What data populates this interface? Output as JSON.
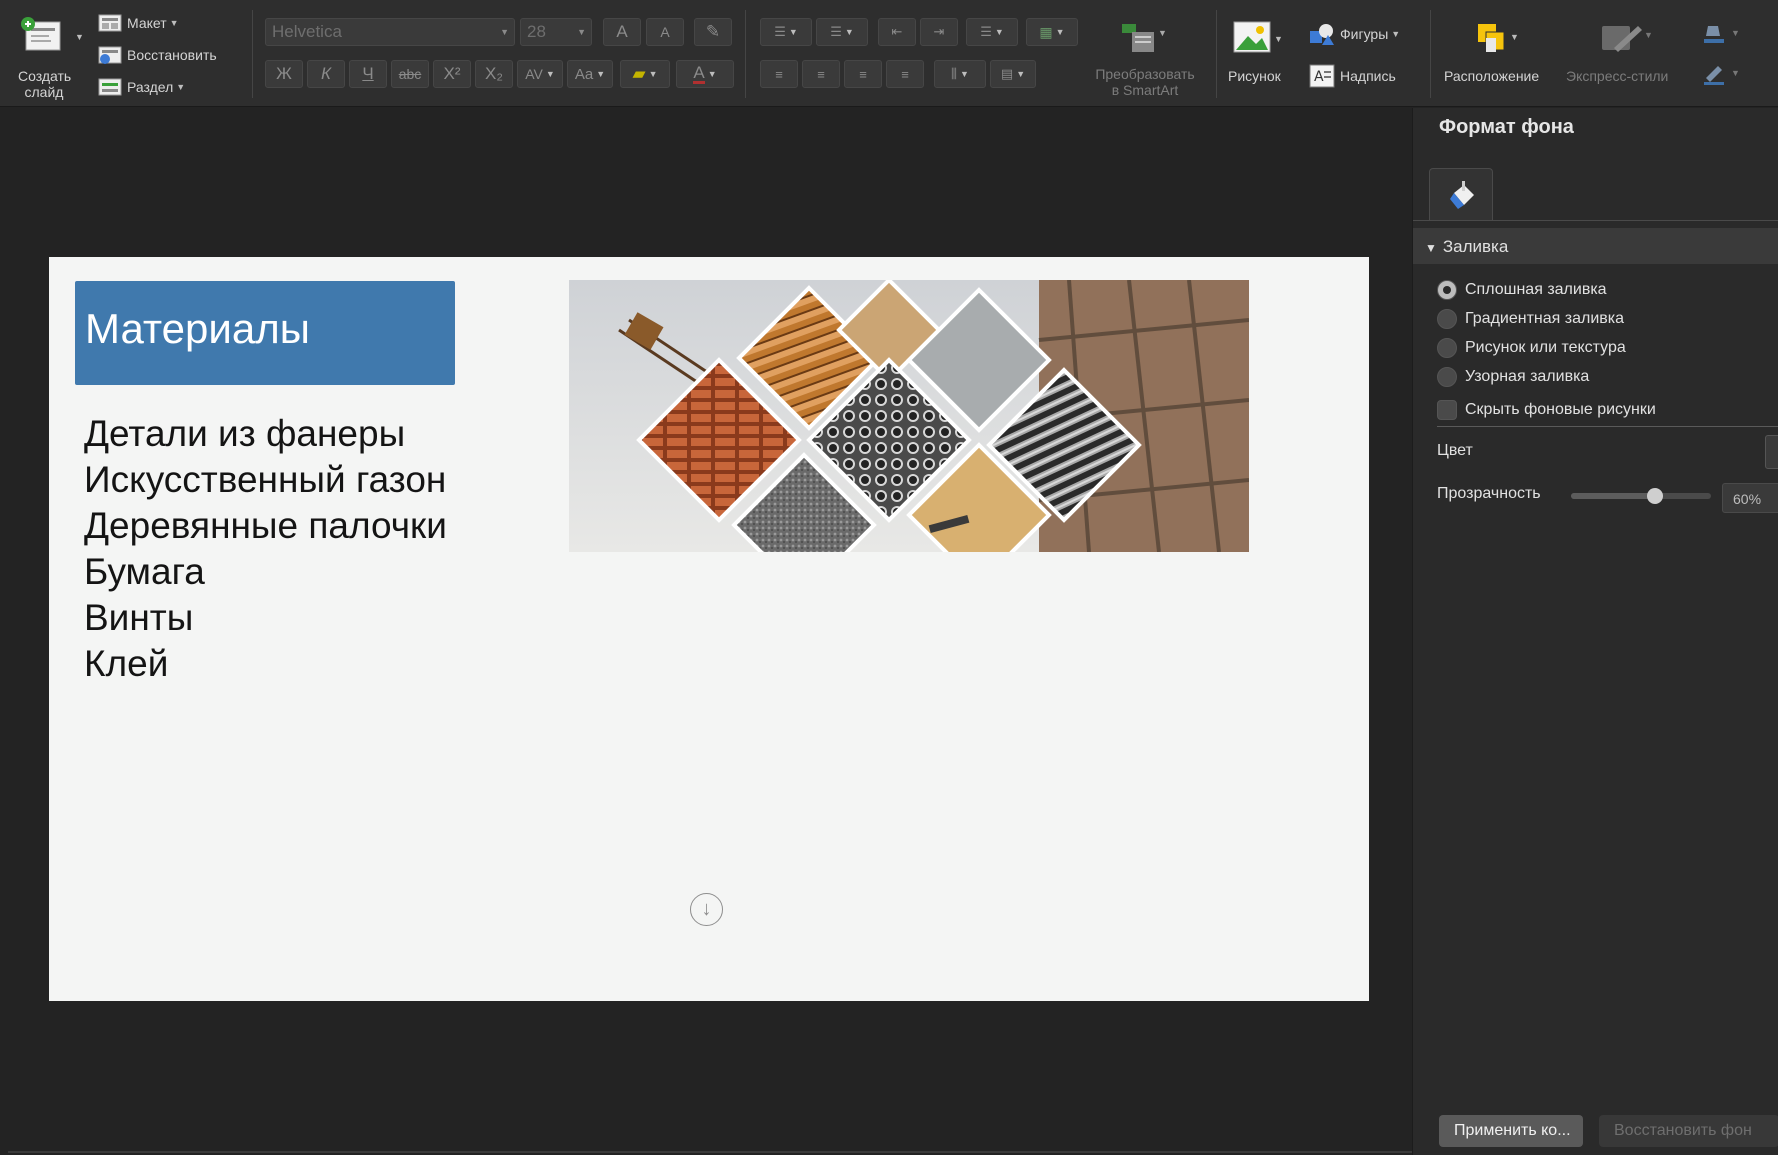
{
  "ribbon": {
    "create_slide": {
      "line1": "Создать",
      "line2": "слайд"
    },
    "layout": "Макет",
    "reset": "Восстановить",
    "section": "Раздел",
    "font_name": "Helvetica",
    "font_size": "28",
    "font_grow": "A",
    "font_shrink": "A",
    "bold": "Ж",
    "italic": "К",
    "underline": "Ч",
    "strike": "abc",
    "superscript": "X²",
    "subscript": "X₂",
    "spacing": "AV",
    "case": "Aa",
    "font_color": "A",
    "smartart": {
      "line1": "Преобразовать",
      "line2": "в SmartArt"
    },
    "picture": "Рисунок",
    "shapes": "Фигуры",
    "textbox": "Надпись",
    "arrange": "Расположение",
    "quick_styles": "Экспресс-стили"
  },
  "slide": {
    "title": "Материалы",
    "bullets": [
      "Детали из фанеры",
      "Искусственный газон",
      "Деревянные палочки",
      "Бумага",
      "Винты",
      "Клей"
    ]
  },
  "panel": {
    "title": "Формат фона",
    "section": "Заливка",
    "options": [
      {
        "label": "Сплошная заливка",
        "selected": true
      },
      {
        "label": "Градиентная заливка",
        "selected": false
      },
      {
        "label": "Рисунок или текстура",
        "selected": false
      },
      {
        "label": "Узорная заливка",
        "selected": false
      }
    ],
    "hide_bg": "Скрыть фоновые рисунки",
    "color_label": "Цвет",
    "transparency_label": "Прозрачность",
    "transparency_value": "60%",
    "transparency_fraction": 0.6,
    "apply_button": "Применить ко...",
    "reset_button": "Восстановить фон"
  },
  "colors": {
    "title_box": "#4079ad",
    "slide_bg": "#f4f5f4",
    "accent_yellow": "#f6c40c"
  }
}
